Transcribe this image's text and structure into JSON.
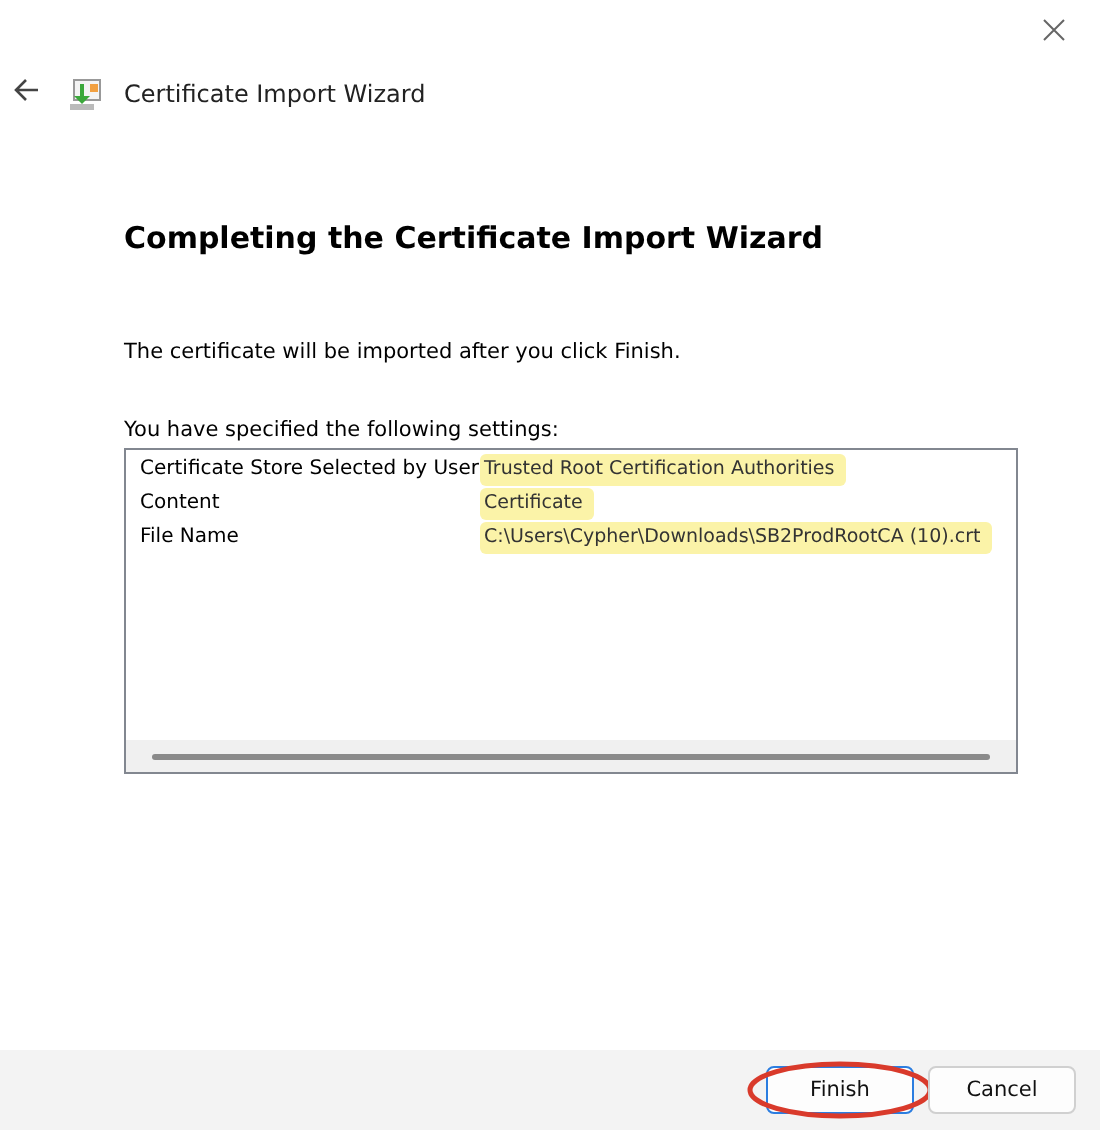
{
  "window": {
    "title": "Certificate Import Wizard"
  },
  "heading": "Completing the Certificate Import Wizard",
  "message": "The certificate will be imported after you click Finish.",
  "settings_label": "You have specified the following settings:",
  "settings": [
    {
      "name": "Certificate Store Selected by User",
      "value": "Trusted Root Certification Authorities",
      "highlighted": true
    },
    {
      "name": "Content",
      "value": "Certificate",
      "highlighted": true
    },
    {
      "name": "File Name",
      "value": "C:\\Users\\Cypher\\Downloads\\SB2ProdRootCA (10).crt",
      "highlighted": true
    }
  ],
  "buttons": [
    {
      "label": "Finish",
      "default": true,
      "circled": true
    },
    {
      "label": "Cancel",
      "default": false,
      "circled": false
    }
  ]
}
